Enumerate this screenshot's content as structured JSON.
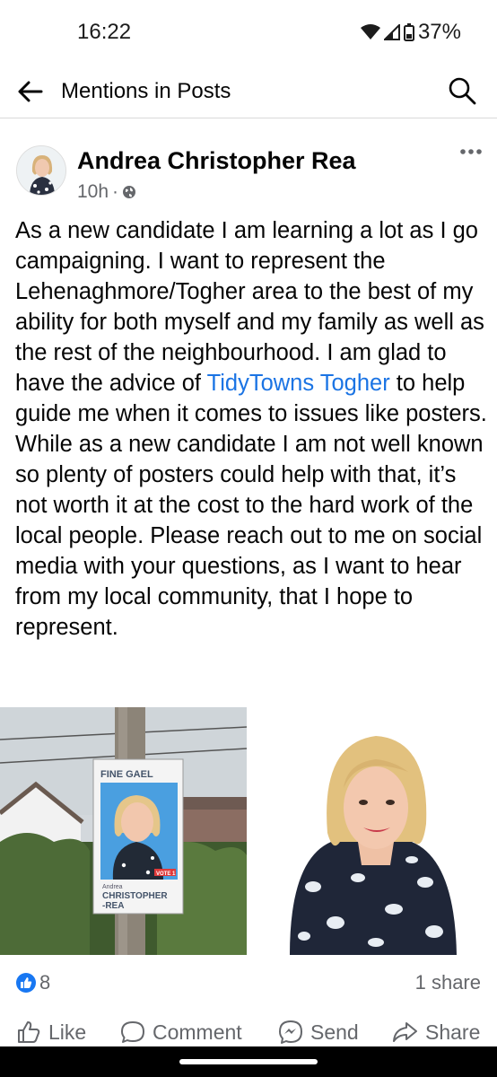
{
  "status_bar": {
    "time": "16:22",
    "battery": "37%"
  },
  "header": {
    "title": "Mentions in Posts",
    "back_icon": "arrow-left-icon",
    "search_icon": "search-icon"
  },
  "post": {
    "author": "Andrea Christopher Rea",
    "time": "10h",
    "separator": "·",
    "audience_icon": "globe-icon",
    "text_before_link": "As a new candidate I am learning a lot as I go campaigning. I want to represent the Lehenaghmore/Togher area to the best of my ability for both myself and my family as well as the rest of the neighbourhood.  I am glad to have the advice of ",
    "link_text": "TidyTowns Togher",
    "text_after_link": " to help guide me when it comes to issues like posters. While as a new candidate I am not well known so plenty of posters could help with that, it’s not worth it at the cost to the hard work of the local people. Please reach out to me on social media with your questions, as I want to hear from my local community, that I hope to represent.",
    "poster": {
      "party": "FINE GAEL",
      "vote": "VOTE 1",
      "first_name": "Andrea",
      "surname_1": "CHRISTOPHER",
      "surname_2": "-REA"
    },
    "like_count": "8",
    "share_count": "1 share"
  },
  "actions": {
    "like": "Like",
    "comment": "Comment",
    "send": "Send",
    "share": "Share"
  },
  "colors": {
    "link": "#1b74e4",
    "meta": "#65676b",
    "like_badge": "#1877f2"
  }
}
